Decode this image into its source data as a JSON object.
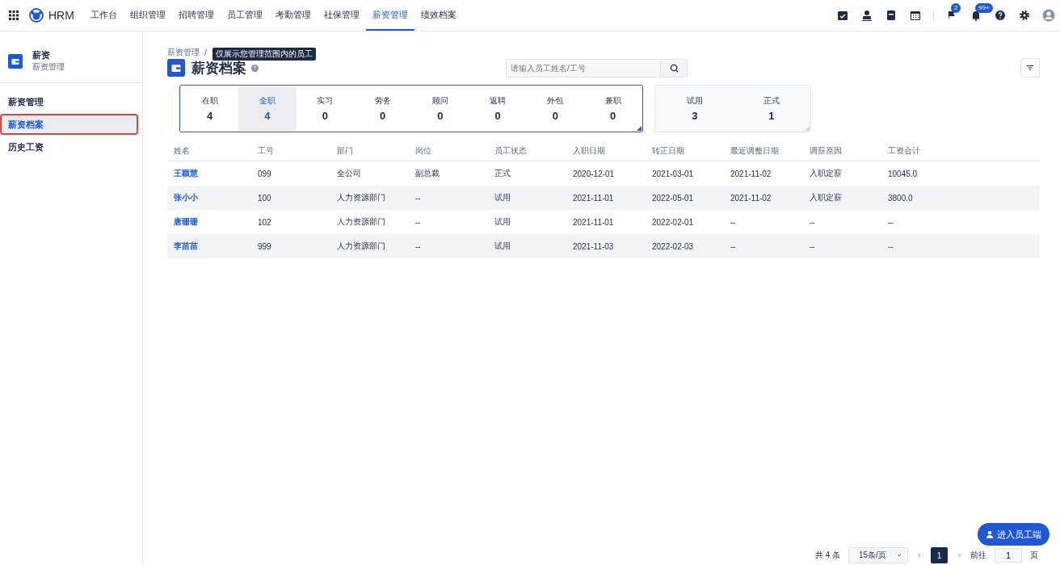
{
  "app": {
    "name": "HRM"
  },
  "nav": [
    {
      "label": "工作台",
      "selected": false
    },
    {
      "label": "组织管理",
      "selected": false
    },
    {
      "label": "招聘管理",
      "selected": false
    },
    {
      "label": "员工管理",
      "selected": false
    },
    {
      "label": "考勤管理",
      "selected": false
    },
    {
      "label": "社保管理",
      "selected": false
    },
    {
      "label": "薪资管理",
      "selected": true
    },
    {
      "label": "绩效档案",
      "selected": false
    }
  ],
  "toolbar": [
    {
      "kind": "task"
    },
    {
      "kind": "person"
    },
    {
      "kind": "document"
    },
    {
      "kind": "calendar"
    },
    {
      "kind": "flag",
      "badge": "2"
    },
    {
      "kind": "bell",
      "badge": "99+"
    },
    {
      "kind": "help"
    },
    {
      "kind": "settings"
    },
    {
      "kind": "avatar"
    }
  ],
  "sidebar": {
    "title": "薪资",
    "subtitle": "薪资管理",
    "items": [
      {
        "label": "薪资管理",
        "selected": false,
        "outlined": false
      },
      {
        "label": "薪资档案",
        "selected": true,
        "outlined": true
      },
      {
        "label": "历史工资",
        "selected": false,
        "outlined": false
      }
    ]
  },
  "breadcrumb": [
    {
      "label": "薪资管理",
      "separator": "/"
    }
  ],
  "tooltip": "仅展示您管理范围内的员工",
  "page_title": "薪资档案",
  "search": {
    "placeholder": "请输入员工姓名/工号"
  },
  "stat_groups": [
    {
      "active": true,
      "items": [
        {
          "label": "在职",
          "value": "4",
          "selected": false
        },
        {
          "label": "全职",
          "value": "4",
          "selected": true
        },
        {
          "label": "实习",
          "value": "0",
          "selected": false
        },
        {
          "label": "劳务",
          "value": "0",
          "selected": false
        },
        {
          "label": "顾问",
          "value": "0",
          "selected": false
        },
        {
          "label": "返聘",
          "value": "0",
          "selected": false
        },
        {
          "label": "外包",
          "value": "0",
          "selected": false
        },
        {
          "label": "兼职",
          "value": "0",
          "selected": false
        }
      ]
    },
    {
      "active": false,
      "items": [
        {
          "label": "试用",
          "value": "3",
          "selected": false
        },
        {
          "label": "正式",
          "value": "1",
          "selected": false
        }
      ]
    }
  ],
  "table": {
    "columns": [
      "姓名",
      "工号",
      "部门",
      "岗位",
      "员工状态",
      "入职日期",
      "转正日期",
      "最近调整日期",
      "调薪原因",
      "工资合计"
    ],
    "rows": [
      [
        "王颖慧",
        "099",
        "全公司",
        "副总裁",
        "正式",
        "2020-12-01",
        "2021-03-01",
        "2021-11-02",
        "入职定薪",
        "10045.0"
      ],
      [
        "张小小",
        "100",
        "人力资源部门",
        "--",
        "试用",
        "2021-11-01",
        "2022-05-01",
        "2021-11-02",
        "入职定薪",
        "3800.0"
      ],
      [
        "唐珊珊",
        "102",
        "人力资源部门",
        "--",
        "试用",
        "2021-11-01",
        "2022-02-01",
        "--",
        "--",
        "--"
      ],
      [
        "李苗苗",
        "999",
        "人力资源部门",
        "--",
        "试用",
        "2021-11-03",
        "2022-02-03",
        "--",
        "--",
        "--"
      ]
    ]
  },
  "pagination": {
    "total": "共 4 条",
    "page_size": "15条/页",
    "pages": [
      {
        "label": "1",
        "selected": true
      }
    ],
    "goto_label": "前往",
    "goto_value": "1",
    "goto_suffix": "页"
  },
  "float_button": "进入员工端"
}
